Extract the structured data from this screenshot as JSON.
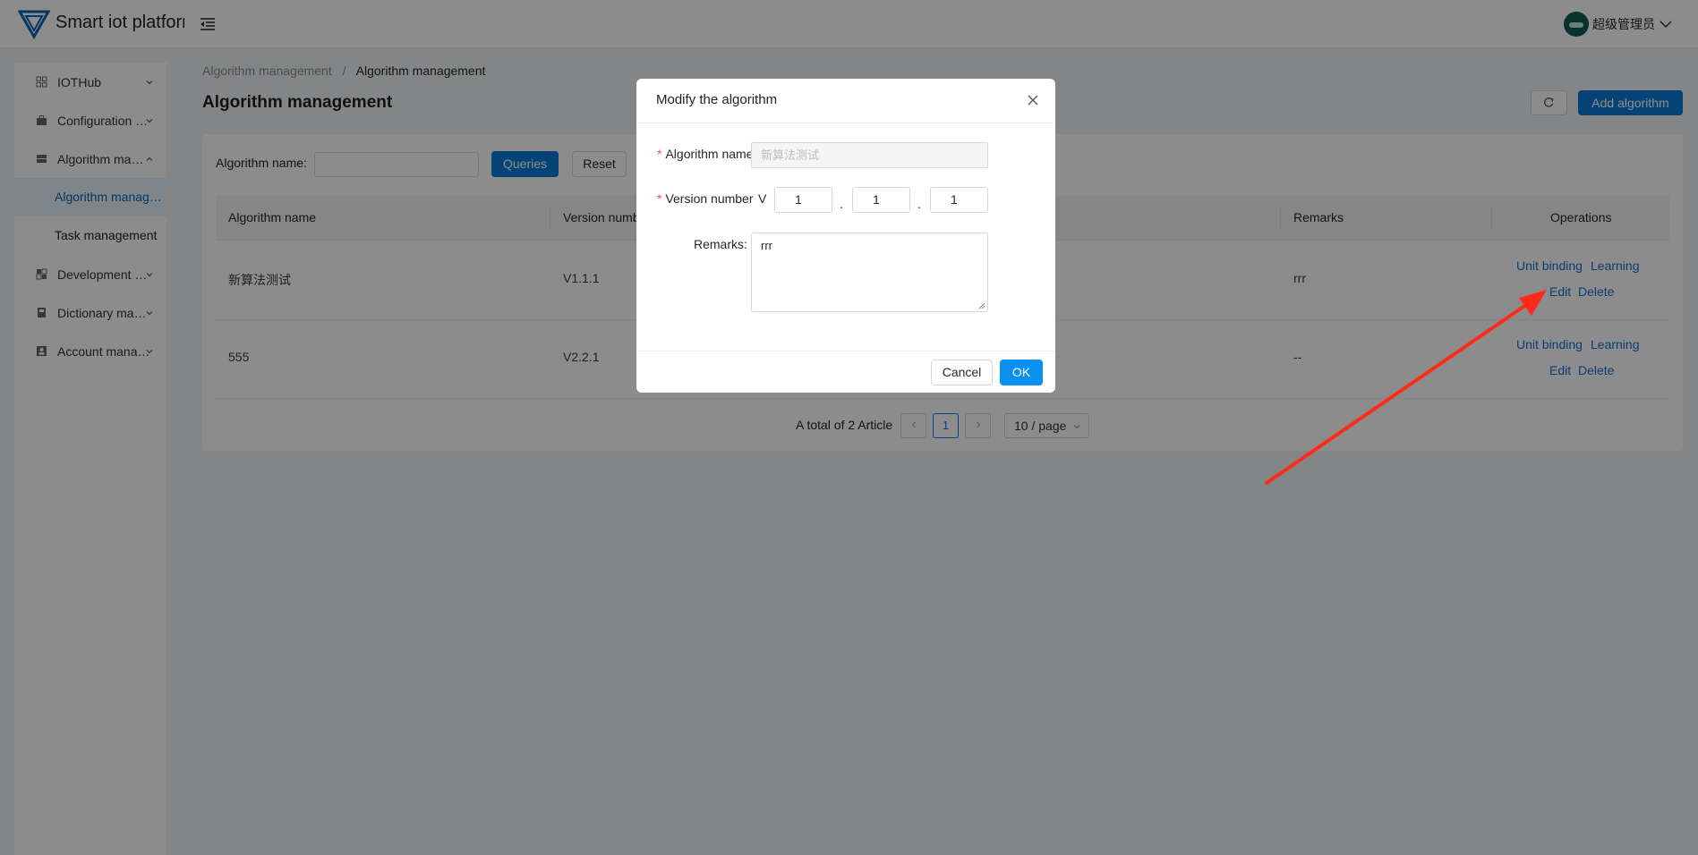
{
  "header": {
    "app_title": "Smart iot platform",
    "user_name": "超级管理员"
  },
  "sidebar": {
    "items": [
      {
        "label": "IOTHub",
        "icon": "grid-icon"
      },
      {
        "label": "Configuration management",
        "icon": "briefcase-icon"
      },
      {
        "label": "Algorithm management",
        "icon": "layers-icon"
      },
      {
        "label": "Development management",
        "icon": "apps-icon"
      },
      {
        "label": "Dictionary management",
        "icon": "book-icon"
      },
      {
        "label": "Account management",
        "icon": "account-icon"
      }
    ],
    "subitems": [
      {
        "label": "Algorithm management",
        "active": true
      },
      {
        "label": "Task management",
        "active": false
      }
    ]
  },
  "breadcrumb": {
    "parent": "Algorithm management",
    "separator": "/",
    "current": "Algorithm management"
  },
  "page": {
    "title": "Algorithm management",
    "add_label": "Add algorithm"
  },
  "search": {
    "label": "Algorithm name:",
    "value": "",
    "queries_label": "Queries",
    "reset_label": "Reset"
  },
  "table": {
    "headers": [
      "Algorithm name",
      "Version number",
      "Remarks",
      "Operations"
    ],
    "rows": [
      {
        "name": "新算法测试",
        "version": "V1.1.1",
        "remarks": "rrr",
        "ops": [
          "Unit binding",
          "Learning",
          "Edit",
          "Delete"
        ]
      },
      {
        "name": "555",
        "version": "V2.2.1",
        "remarks": "--",
        "ops": [
          "Unit binding",
          "Learning",
          "Edit",
          "Delete"
        ]
      }
    ]
  },
  "pagination": {
    "total_text": "A total of 2 Article",
    "current_page": "1",
    "page_size": "10 / page"
  },
  "modal": {
    "title": "Modify the algorithm",
    "name_label": "Algorithm name",
    "name_value": "新算法测试",
    "version_label": "Version number",
    "version_prefix": "V",
    "version_parts": [
      "1",
      "1",
      "1"
    ],
    "version_sep": ".",
    "remarks_label": "Remarks:",
    "remarks_value": "rrr",
    "cancel_label": "Cancel",
    "ok_label": "OK"
  },
  "colors": {
    "primary": "#0a7ad9",
    "annotation_arrow": "#ff2a1a",
    "required_mark": "#ff4d4f"
  }
}
